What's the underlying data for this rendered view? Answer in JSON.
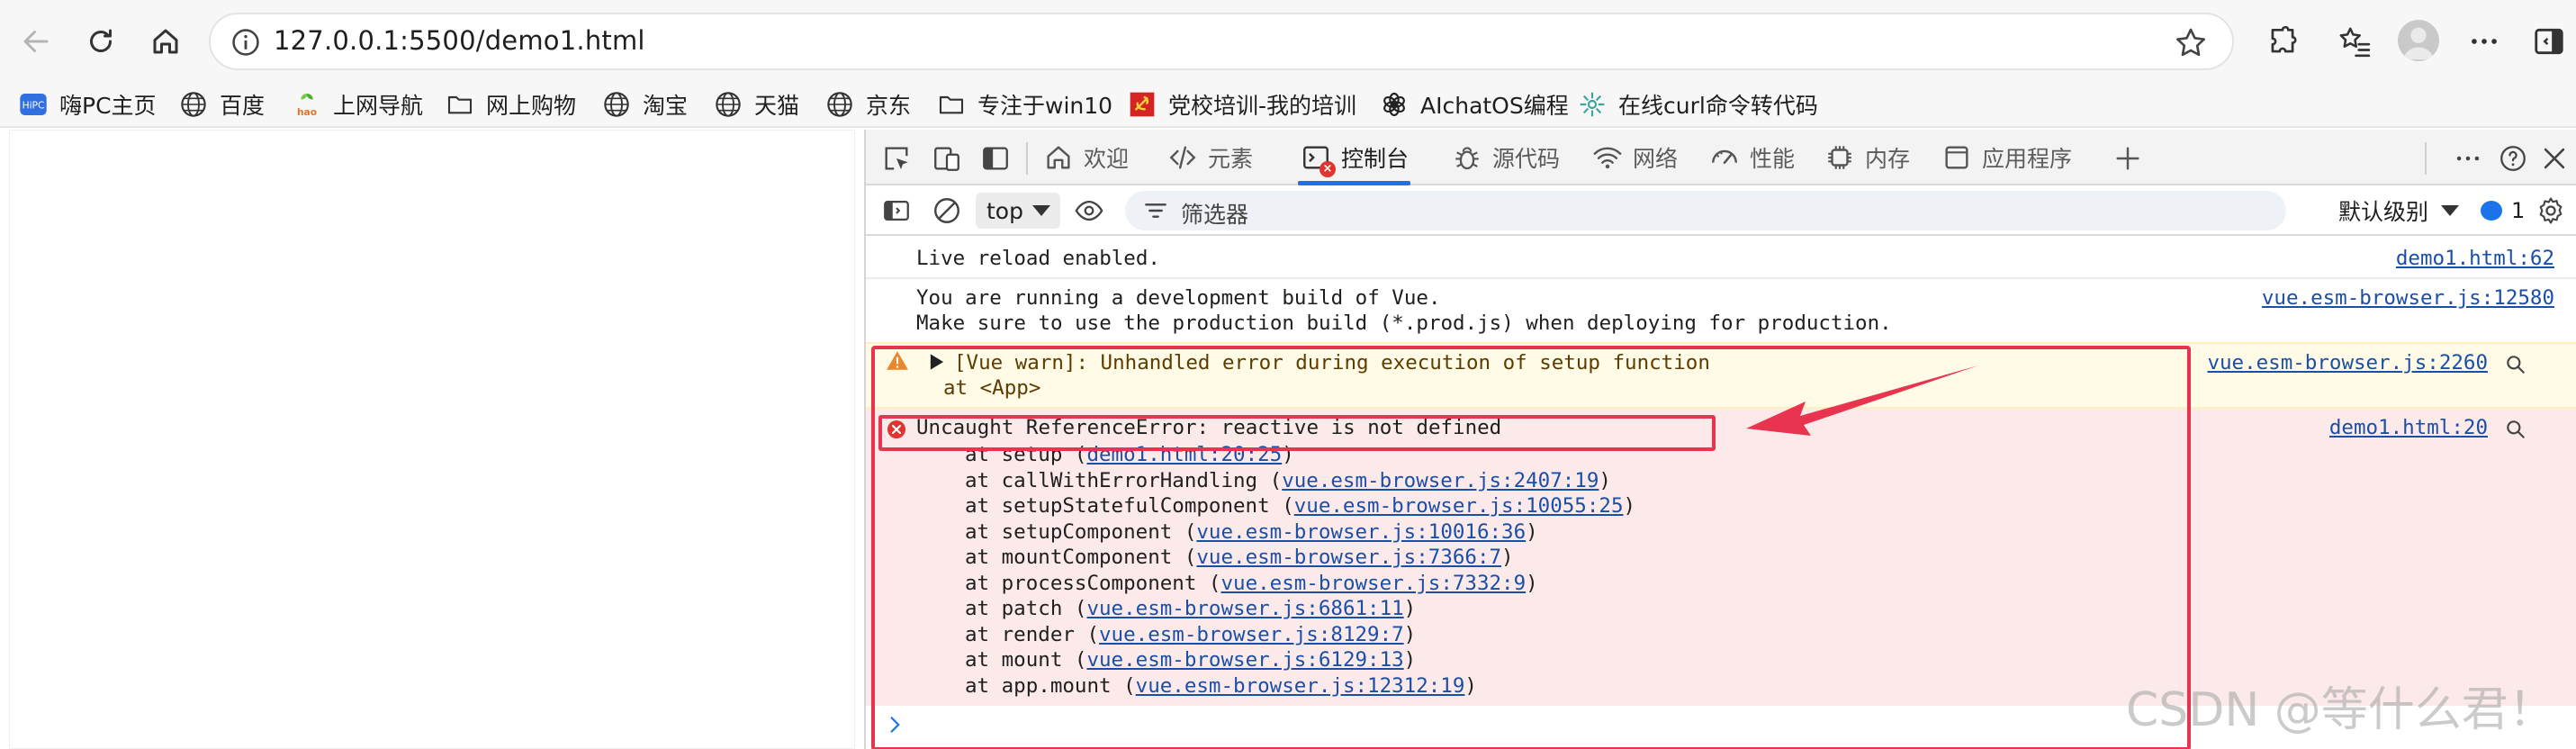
{
  "browser": {
    "url": "127.0.0.1:5500/demo1.html",
    "bookmarks": [
      {
        "label": "嗨PC主页",
        "icon": "hipc-icon"
      },
      {
        "label": "百度",
        "icon": "globe-icon"
      },
      {
        "label": "上网导航",
        "icon": "hao-icon"
      },
      {
        "label": "网上购物",
        "icon": "folder-icon"
      },
      {
        "label": "淘宝",
        "icon": "globe-icon"
      },
      {
        "label": "天猫",
        "icon": "globe-icon"
      },
      {
        "label": "京东",
        "icon": "globe-icon"
      },
      {
        "label": "专注于win10",
        "icon": "folder-icon"
      },
      {
        "label": "党校培训-我的培训",
        "icon": "party-icon"
      },
      {
        "label": "AIchatOS编程",
        "icon": "openai-icon"
      },
      {
        "label": "在线curl命令转代码",
        "icon": "gear-flower-icon"
      }
    ]
  },
  "devtools": {
    "tabs": [
      {
        "label": "欢迎",
        "icon": "home-icon"
      },
      {
        "label": "元素",
        "icon": "code-icon"
      },
      {
        "label": "控制台",
        "icon": "console-icon",
        "active": true
      },
      {
        "label": "源代码",
        "icon": "bug-icon"
      },
      {
        "label": "网络",
        "icon": "wifi-icon"
      },
      {
        "label": "性能",
        "icon": "performance-icon"
      },
      {
        "label": "内存",
        "icon": "memory-icon"
      },
      {
        "label": "应用程序",
        "icon": "application-icon"
      }
    ],
    "toolbar": {
      "context": "top",
      "filter_placeholder": "筛选器",
      "level": "默认级别",
      "issues_count": "1"
    }
  },
  "console": {
    "live_reload": {
      "text": "Live reload enabled.",
      "source": "demo1.html:62"
    },
    "dev_build": {
      "line1": "You are running a development build of Vue.",
      "line2": "Make sure to use the production build (*.prod.js) when deploying for production.",
      "source": "vue.esm-browser.js:12580"
    },
    "warning": {
      "line1": "[Vue warn]: Unhandled error during execution of setup function",
      "line2": "at <App>",
      "source": "vue.esm-browser.js:2260"
    },
    "error": {
      "message": "Uncaught ReferenceError: reactive is not defined",
      "source": "demo1.html:20",
      "stack": [
        {
          "fn": "at setup (",
          "link": "demo1.html:20:25"
        },
        {
          "fn": "at callWithErrorHandling (",
          "link": "vue.esm-browser.js:2407:19"
        },
        {
          "fn": "at setupStatefulComponent (",
          "link": "vue.esm-browser.js:10055:25"
        },
        {
          "fn": "at setupComponent (",
          "link": "vue.esm-browser.js:10016:36"
        },
        {
          "fn": "at mountComponent (",
          "link": "vue.esm-browser.js:7366:7"
        },
        {
          "fn": "at processComponent (",
          "link": "vue.esm-browser.js:7332:9"
        },
        {
          "fn": "at patch (",
          "link": "vue.esm-browser.js:6861:11"
        },
        {
          "fn": "at render (",
          "link": "vue.esm-browser.js:8129:7"
        },
        {
          "fn": "at mount (",
          "link": "vue.esm-browser.js:6129:13"
        },
        {
          "fn": "at app.mount (",
          "link": "vue.esm-browser.js:12312:19"
        }
      ]
    }
  },
  "watermark": "CSDN @等什么君！",
  "colors": {
    "accent": "#1a73e8",
    "annotation": "#e8344f",
    "warning_bg": "#fffbe6",
    "error_bg": "#fceaea",
    "link": "#1a4fa8"
  }
}
